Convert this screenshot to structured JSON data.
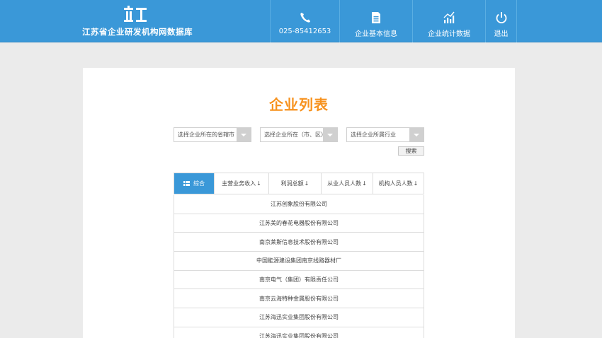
{
  "header": {
    "site_title": "江苏省企业研发机构网数据库",
    "logo": "ZYJ-logo",
    "nav": [
      {
        "icon": "phone-icon",
        "label": "025-85412653"
      },
      {
        "icon": "document-icon",
        "label": "企业基本信息"
      },
      {
        "icon": "bar-chart-icon",
        "label": "企业统计数据"
      },
      {
        "icon": "power-icon",
        "label": "退出"
      }
    ]
  },
  "main": {
    "title": "企业列表",
    "filters": {
      "province": "选择企业所在的省辖市",
      "city": "选择企业所在（市、区）",
      "industry": "选择企业所属行业",
      "search_label": "搜索"
    },
    "tabs": [
      {
        "label": "综合",
        "active": true
      },
      {
        "label": "主营业务收入",
        "arrow": "↓"
      },
      {
        "label": "利润总额",
        "arrow": "↓"
      },
      {
        "label": "从业人员人数",
        "arrow": "↓"
      },
      {
        "label": "机构人员人数",
        "arrow": "↓"
      }
    ],
    "companies": [
      "江苏创象股份有限公司",
      "江苏美的春花电器股份有限公司",
      "南京莱斯信息技术股份有限公司",
      "中国能源建设集团南京线路器材厂",
      "南京电气（集团）有限责任公司",
      "南京云海特种金属股份有限公司",
      "江苏海迅实业集团股份有限公司",
      "江苏海迅实业集团股份有限公司"
    ]
  },
  "colors": {
    "header_bg": "#3a98d8",
    "title_accent": "#f7921e",
    "active_tab": "#3a98d8"
  }
}
